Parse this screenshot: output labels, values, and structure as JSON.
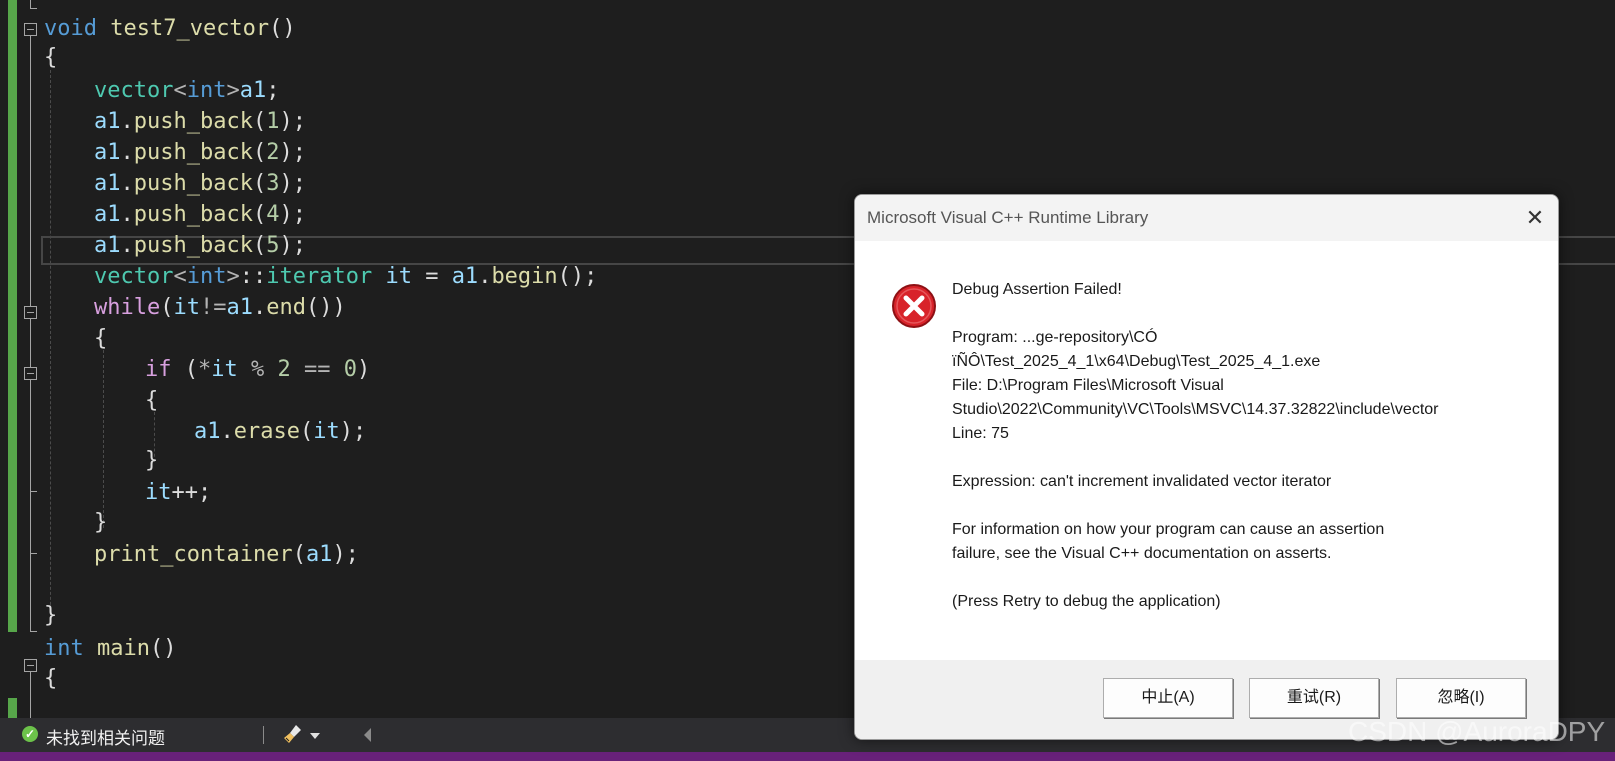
{
  "editor": {
    "lines": [
      {
        "tokens": [
          {
            "t": "void",
            "c": "kw"
          },
          {
            "t": " test7_vector",
            "c": "fn"
          },
          {
            "t": "()",
            "c": "pl"
          }
        ]
      },
      {
        "tokens": [
          {
            "t": "{",
            "c": "pl"
          }
        ]
      },
      {
        "tokens": []
      },
      {
        "tokens": [
          {
            "t": "vector",
            "c": "ty"
          },
          {
            "t": "<",
            "c": "op"
          },
          {
            "t": "int",
            "c": "kw"
          },
          {
            "t": ">",
            "c": "op"
          },
          {
            "t": "a1",
            "c": "var"
          },
          {
            "t": ";",
            "c": "pl"
          }
        ]
      },
      {
        "tokens": [
          {
            "t": "a1",
            "c": "var"
          },
          {
            "t": ".",
            "c": "pl"
          },
          {
            "t": "push_back",
            "c": "fn"
          },
          {
            "t": "(",
            "c": "pl"
          },
          {
            "t": "1",
            "c": "num"
          },
          {
            "t": ");",
            "c": "pl"
          }
        ]
      },
      {
        "tokens": [
          {
            "t": "a1",
            "c": "var"
          },
          {
            "t": ".",
            "c": "pl"
          },
          {
            "t": "push_back",
            "c": "fn"
          },
          {
            "t": "(",
            "c": "pl"
          },
          {
            "t": "2",
            "c": "num"
          },
          {
            "t": ");",
            "c": "pl"
          }
        ]
      },
      {
        "tokens": [
          {
            "t": "a1",
            "c": "var"
          },
          {
            "t": ".",
            "c": "pl"
          },
          {
            "t": "push_back",
            "c": "fn"
          },
          {
            "t": "(",
            "c": "pl"
          },
          {
            "t": "3",
            "c": "num"
          },
          {
            "t": ");",
            "c": "pl"
          }
        ]
      },
      {
        "tokens": [
          {
            "t": "a1",
            "c": "var"
          },
          {
            "t": ".",
            "c": "pl"
          },
          {
            "t": "push_back",
            "c": "fn"
          },
          {
            "t": "(",
            "c": "pl"
          },
          {
            "t": "4",
            "c": "num"
          },
          {
            "t": ");",
            "c": "pl"
          }
        ]
      },
      {
        "tokens": [
          {
            "t": "a1",
            "c": "var"
          },
          {
            "t": ".",
            "c": "pl"
          },
          {
            "t": "push_back",
            "c": "fn"
          },
          {
            "t": "(",
            "c": "pl"
          },
          {
            "t": "5",
            "c": "num"
          },
          {
            "t": ");",
            "c": "pl"
          }
        ]
      },
      {
        "tokens": [
          {
            "t": "vector",
            "c": "ty"
          },
          {
            "t": "<",
            "c": "op"
          },
          {
            "t": "int",
            "c": "kw"
          },
          {
            "t": ">",
            "c": "op"
          },
          {
            "t": "::",
            "c": "pl"
          },
          {
            "t": "iterator",
            "c": "ty"
          },
          {
            "t": " it ",
            "c": "var"
          },
          {
            "t": "= ",
            "c": "pl"
          },
          {
            "t": "a1",
            "c": "var"
          },
          {
            "t": ".",
            "c": "pl"
          },
          {
            "t": "begin",
            "c": "fn"
          },
          {
            "t": "();",
            "c": "pl"
          }
        ]
      },
      {
        "tokens": [
          {
            "t": "while",
            "c": "ctl"
          },
          {
            "t": "(",
            "c": "pl"
          },
          {
            "t": "it",
            "c": "var"
          },
          {
            "t": "!=",
            "c": "op"
          },
          {
            "t": "a1",
            "c": "var"
          },
          {
            "t": ".",
            "c": "pl"
          },
          {
            "t": "end",
            "c": "fn"
          },
          {
            "t": "())",
            "c": "pl"
          }
        ]
      },
      {
        "tokens": [
          {
            "t": "{",
            "c": "pl"
          }
        ]
      },
      {
        "tokens": [
          {
            "t": "if",
            "c": "ctl"
          },
          {
            "t": " (",
            "c": "pl"
          },
          {
            "t": "*",
            "c": "op"
          },
          {
            "t": "it",
            "c": "var"
          },
          {
            "t": " % ",
            "c": "op"
          },
          {
            "t": "2",
            "c": "num"
          },
          {
            "t": " == ",
            "c": "op"
          },
          {
            "t": "0",
            "c": "num"
          },
          {
            "t": ")",
            "c": "pl"
          }
        ]
      },
      {
        "tokens": [
          {
            "t": "{",
            "c": "pl"
          }
        ]
      },
      {
        "tokens": [
          {
            "t": "a1",
            "c": "var"
          },
          {
            "t": ".",
            "c": "pl"
          },
          {
            "t": "erase",
            "c": "fn"
          },
          {
            "t": "(",
            "c": "pl"
          },
          {
            "t": "it",
            "c": "var"
          },
          {
            "t": ");",
            "c": "pl"
          }
        ]
      },
      {
        "tokens": [
          {
            "t": "}",
            "c": "pl"
          }
        ]
      },
      {
        "tokens": [
          {
            "t": "it",
            "c": "var"
          },
          {
            "t": "++;",
            "c": "pl"
          }
        ]
      },
      {
        "tokens": [
          {
            "t": "}",
            "c": "pl"
          }
        ]
      },
      {
        "tokens": [
          {
            "t": "print_container",
            "c": "fn"
          },
          {
            "t": "(",
            "c": "pl"
          },
          {
            "t": "a1",
            "c": "var"
          },
          {
            "t": ");",
            "c": "pl"
          }
        ]
      },
      {
        "tokens": []
      },
      {
        "tokens": [
          {
            "t": "}",
            "c": "pl"
          }
        ]
      },
      {
        "tokens": [
          {
            "t": "int",
            "c": "kw"
          },
          {
            "t": " main",
            "c": "fn"
          },
          {
            "t": "()",
            "c": "pl"
          }
        ]
      },
      {
        "tokens": [
          {
            "t": "{",
            "c": "pl"
          }
        ]
      }
    ]
  },
  "status_bar": {
    "issues_text": "未找到相关问题",
    "issues_icon": "check-circle-icon",
    "cleanup_icon": "brush-icon",
    "status_color": "#6cc24a"
  },
  "dialog": {
    "title": "Microsoft Visual C++ Runtime Library",
    "close_icon": "close-icon",
    "error_icon": "error-circle-icon",
    "heading": "Debug Assertion Failed!",
    "program_line1": "Program: ...ge-repository\\CÓ",
    "program_line2": "ïÑÔ\\Test_2025_4_1\\x64\\Debug\\Test_2025_4_1.exe",
    "file_line1": "File: D:\\Program Files\\Microsoft Visual",
    "file_line2": "Studio\\2022\\Community\\VC\\Tools\\MSVC\\14.37.32822\\include\\vector",
    "line_info": "Line: 75",
    "expression": "Expression: can't increment invalidated vector iterator",
    "info_line1": "For information on how your program can cause an assertion",
    "info_line2": "failure, see the Visual C++ documentation on asserts.",
    "press_retry": "(Press Retry to debug the application)",
    "buttons": {
      "abort": "中止(A)",
      "retry": "重试(R)",
      "ignore": "忽略(I)"
    },
    "error_color": "#d8232a"
  },
  "watermark": "CSDN @AuroraDPY"
}
